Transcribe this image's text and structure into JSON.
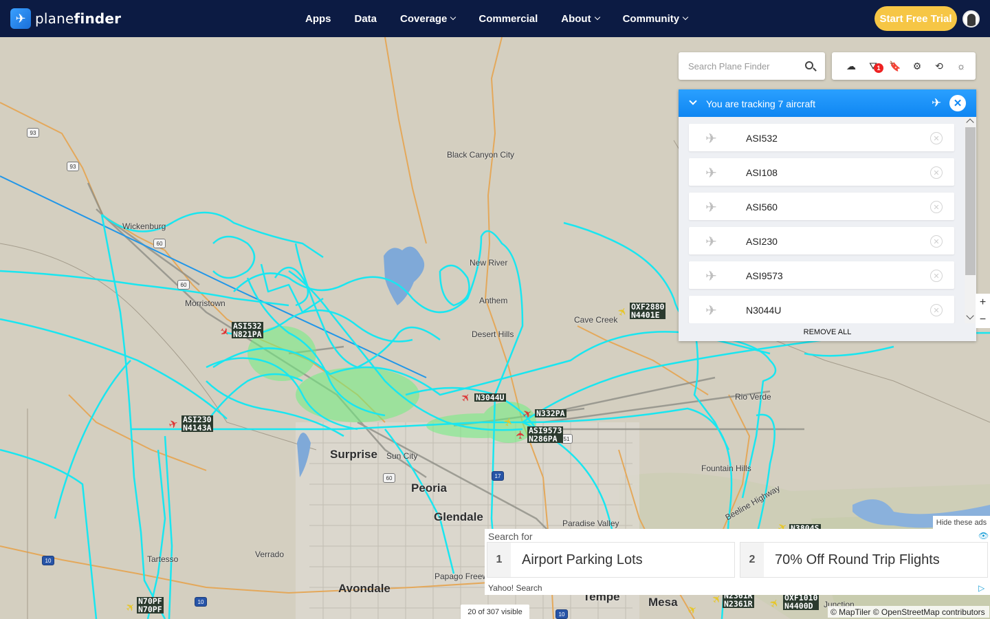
{
  "brand": {
    "name_light": "plane",
    "name_bold": "finder"
  },
  "nav": [
    {
      "label": "Apps"
    },
    {
      "label": "Data"
    },
    {
      "label": "Coverage"
    },
    {
      "label": "Commercial"
    },
    {
      "label": "About"
    },
    {
      "label": "Community"
    }
  ],
  "trial_label": "Start Free Trial",
  "search": {
    "placeholder": "Search Plane Finder"
  },
  "toolbar": {
    "filter_badge": "1"
  },
  "tracking": {
    "title": "You are tracking 7 aircraft",
    "items": [
      "ASI532",
      "ASI108",
      "ASI560",
      "ASI230",
      "ASI9573",
      "N3044U"
    ],
    "remove_all": "REMOVE ALL"
  },
  "map": {
    "places": {
      "black_canyon": "Black Canyon City",
      "wickenburg": "Wickenburg",
      "morristown": "Morristown",
      "new_river": "New River",
      "anthem": "Anthem",
      "cave_creek": "Cave Creek",
      "desert_hills": "Desert Hills",
      "rio_verde": "Rio Verde",
      "surprise": "Surprise",
      "sun_city": "Sun City",
      "peoria": "Peoria",
      "glendale": "Glendale",
      "fountain_hills": "Fountain Hills",
      "beeline": "Beeline Highway",
      "paradise_valley": "Paradise Valley",
      "verrado": "Verrado",
      "tartesso": "Tartesso",
      "papago": "Papago Freeway",
      "avondale": "Avondale",
      "tempe": "Tempe",
      "mesa": "Mesa",
      "junction": "Junction"
    },
    "highways": {
      "h93a": "93",
      "h93b": "93",
      "h60a": "60",
      "h60b": "60",
      "h60c": "60",
      "h17": "17",
      "h10a": "10",
      "h10b": "10",
      "h10c": "10",
      "h51": "51"
    },
    "aircraft": [
      {
        "label": "ASI532\nN821PA"
      },
      {
        "label": "ASI230\nN4143A"
      },
      {
        "label": "N3044U"
      },
      {
        "label": "N332PA"
      },
      {
        "label": "ASI9573\nN286PA"
      },
      {
        "label": "OXF2880\nN4401E"
      },
      {
        "label": "N70PF\nN70PF"
      },
      {
        "label": "N2361R\nN2361R"
      },
      {
        "label": "OXF1010\nN4400D"
      },
      {
        "label": "N3804S"
      }
    ]
  },
  "ad": {
    "hide": "Hide these ads",
    "search_for": "Search for",
    "items": [
      {
        "num": "1",
        "text": "Airport Parking Lots"
      },
      {
        "num": "2",
        "text": "70% Off Round Trip Flights"
      }
    ],
    "footer": "Yahoo! Search"
  },
  "visible_count": "20 of 307 visible",
  "attribution": "© MapTiler © OpenStreetMap contributors",
  "colors": {
    "nav_bg": "#0c1b43",
    "accent": "#1089f4",
    "trial": "#f6c645",
    "track": "#19e6f0"
  }
}
